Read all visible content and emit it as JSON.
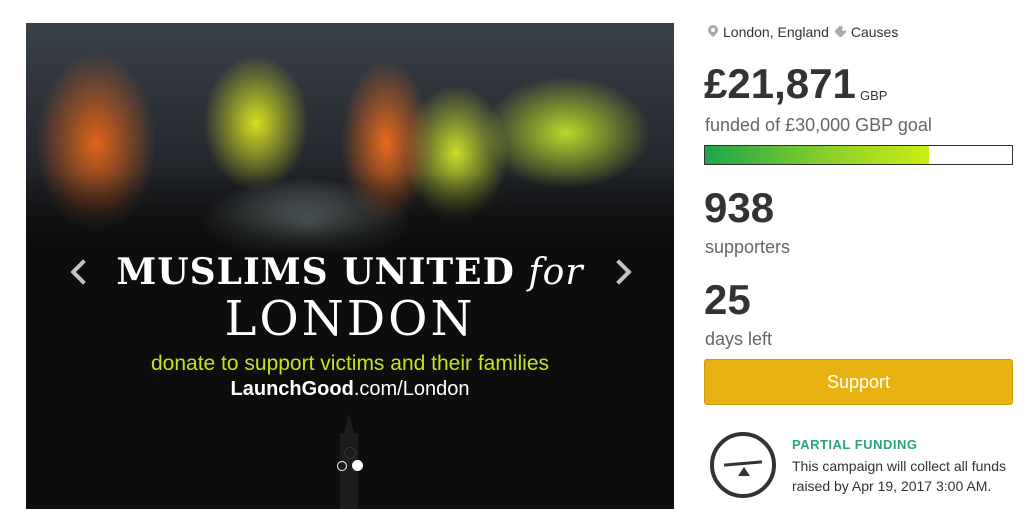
{
  "carousel": {
    "headline_line1": "MUSLIMS UNITED",
    "headline_for": "for",
    "headline_line2": "LONDON",
    "tagline": "donate to support victims and their families",
    "site_brand": "LaunchGood",
    "site_path": ".com/London",
    "slide_count": 2,
    "active_slide": 2
  },
  "campaign": {
    "location": "London, England",
    "category": "Causes",
    "amount": "£21,871",
    "currency": "GBP",
    "goal_text": "funded of £30,000 GBP goal",
    "progress_fraction": 0.729,
    "supporters_count": "938",
    "supporters_label": "supporters",
    "days_count": "25",
    "days_label": "days left",
    "support_button": "Support"
  },
  "partial_funding": {
    "title": "PARTIAL FUNDING",
    "text": "This campaign will collect all funds raised by Apr 19, 2017 3:00 AM."
  },
  "colors": {
    "accent_green": "#2aa57a",
    "tagline_lime": "#c6e21b",
    "button_yellow": "#e9b213"
  },
  "icons": [
    "location-pin-icon",
    "tag-icon",
    "chevron-left-icon",
    "chevron-right-icon",
    "scale-icon"
  ]
}
